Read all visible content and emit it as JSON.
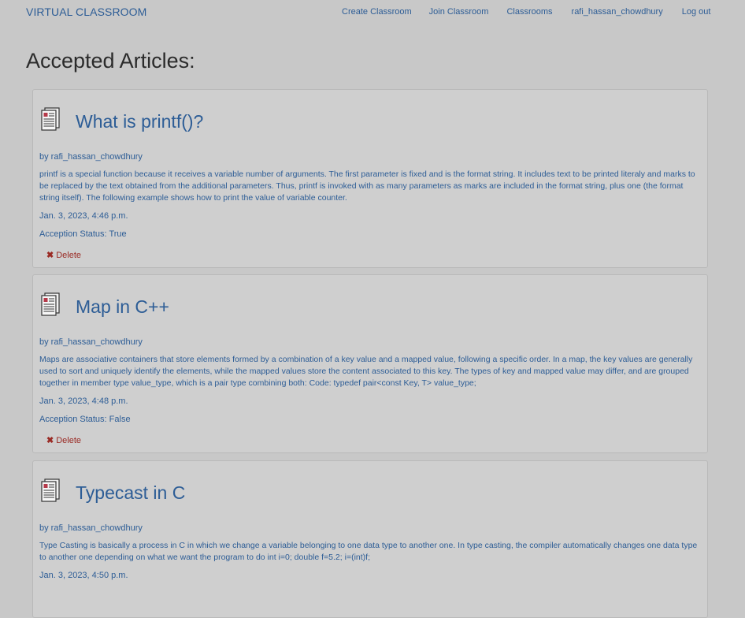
{
  "nav": {
    "brand": "VIRTUAL CLASSROOM",
    "links": [
      "Create Classroom",
      "Join Classroom",
      "Classrooms",
      "rafi_hassan_chowdhury",
      "Log out"
    ]
  },
  "page": {
    "heading": "Accepted Articles:"
  },
  "articles": [
    {
      "title": "What is printf()?",
      "author": "by rafi_hassan_chowdhury",
      "body": "printf is a special function because it receives a variable number of arguments. The first parameter is fixed and is the format string. It includes text to be printed literaly and marks to be replaced by the text obtained from the additional parameters. Thus, printf is invoked with as many parameters as marks are included in the format string, plus one (the format string itself). The following example shows how to print the value of variable counter.",
      "date": "Jan. 3, 2023, 4:46 p.m.",
      "status": "Acception Status: True",
      "delete_label": "Delete"
    },
    {
      "title": "Map in C++",
      "author": "by rafi_hassan_chowdhury",
      "body": "Maps are associative containers that store elements formed by a combination of a key value and a mapped value, following a specific order. In a map, the key values are generally used to sort and uniquely identify the elements, while the mapped values store the content associated to this key. The types of key and mapped value may differ, and are grouped together in member type value_type, which is a pair type combining both: Code: typedef pair<const Key, T> value_type;",
      "date": "Jan. 3, 2023, 4:48 p.m.",
      "status": "Acception Status: False",
      "delete_label": "Delete"
    },
    {
      "title": "Typecast in C",
      "author": "by rafi_hassan_chowdhury",
      "body": "Type Casting is basically a process in C in which we change a variable belonging to one data type to another one. In type casting, the compiler automatically changes one data type to another one depending on what we want the program to do int i=0; double f=5.2; i=(int)f;",
      "date": "Jan. 3, 2023, 4:50 p.m."
    }
  ],
  "icons": {
    "article": "newspaper-icon",
    "delete": "x-icon"
  },
  "colors": {
    "link": "#2d5d96",
    "danger": "#9a2a24",
    "background": "#c8c8c8",
    "card": "#cfcfcf"
  }
}
